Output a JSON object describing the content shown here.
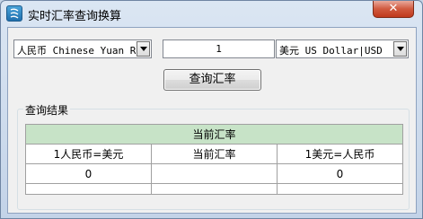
{
  "window": {
    "title": "实时汇率查询换算",
    "close_glyph": "✕"
  },
  "form": {
    "from_currency": "人民币 Chinese Yuan R",
    "amount": "1",
    "to_currency": "美元 US Dollar|USD",
    "query_button": "查询汇率"
  },
  "results": {
    "group_label": "查询结果",
    "table_title": "当前汇率",
    "columns": [
      "1人民币=美元",
      "当前汇率",
      "1美元=人民币"
    ],
    "row": [
      "0",
      "",
      "0"
    ]
  },
  "icons": {
    "app": "currency-app-icon",
    "dropdown": "chevron-down-icon",
    "close": "close-icon"
  },
  "colors": {
    "header_green": "#c7e3c7",
    "close_red": "#c0391c"
  }
}
